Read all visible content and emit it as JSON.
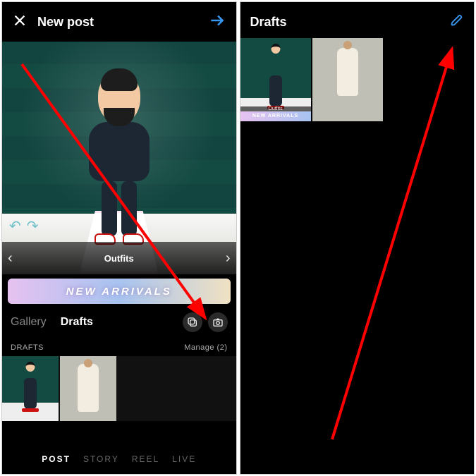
{
  "left": {
    "header": {
      "title": "New post"
    },
    "carousel": {
      "category": "Outfits"
    },
    "banner": {
      "text": "NEW ARRIVALS"
    },
    "source_tabs": {
      "gallery": "Gallery",
      "drafts": "Drafts"
    },
    "drafts_section": {
      "label": "DRAFTS",
      "manage": "Manage (2)"
    },
    "bottom_tabs": {
      "post": "POST",
      "story": "STORY",
      "reel": "REEL",
      "live": "LIVE"
    }
  },
  "right": {
    "header": {
      "title": "Drafts"
    },
    "thumb1": {
      "category": "Outfits",
      "banner": "NEW ARRIVALS"
    }
  }
}
